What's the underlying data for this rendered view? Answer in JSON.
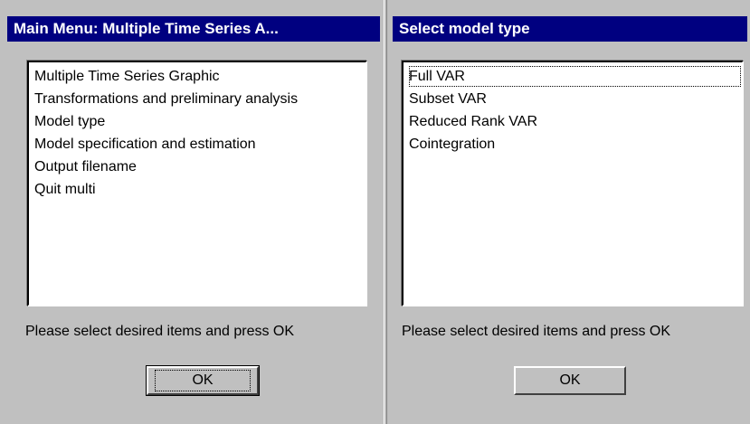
{
  "main_menu": {
    "title": "Main Menu: Multiple Time Series A...",
    "items": [
      "Multiple Time Series Graphic",
      "Transformations and preliminary analysis",
      "Model type",
      "Model specification and estimation",
      "Output filename",
      "Quit multi"
    ],
    "prompt": "Please select desired items and press OK",
    "ok_label": "OK"
  },
  "model_type": {
    "title": "Select model type",
    "items": [
      "Full VAR",
      "Subset VAR",
      "Reduced Rank VAR",
      "Cointegration"
    ],
    "prompt": "Please select desired items and press OK",
    "ok_label": "OK"
  },
  "colors": {
    "titlebar": "#000080",
    "title_text": "#ffffff",
    "face": "#c0c0c0",
    "list_bg": "#ffffff"
  }
}
